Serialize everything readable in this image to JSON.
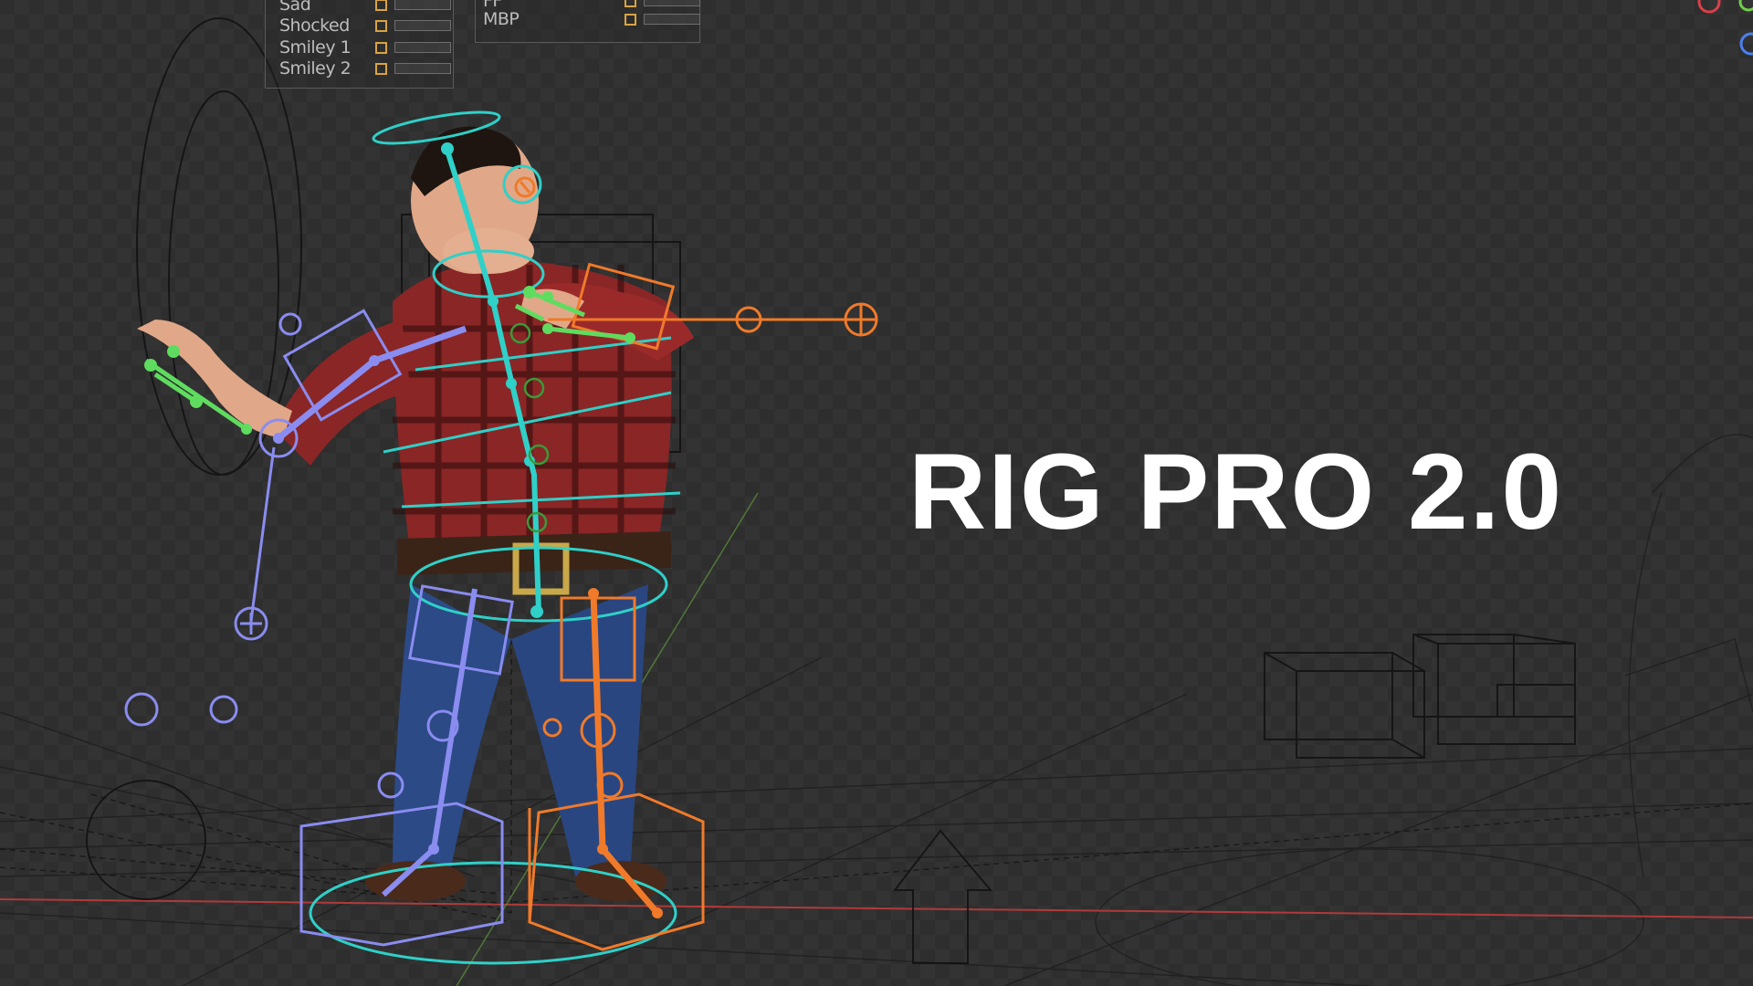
{
  "title": "RIG PRO 2.0",
  "shape_panel_left": {
    "items": [
      {
        "label": "Sad"
      },
      {
        "label": "Shocked"
      },
      {
        "label": "Smiley 1"
      },
      {
        "label": "Smiley 2"
      }
    ]
  },
  "shape_panel_mid": {
    "items": [
      {
        "label": "FF"
      },
      {
        "label": "MBP"
      }
    ]
  },
  "colors": {
    "rig_cyan": "#2fd0c8",
    "rig_orange": "#f07a2a",
    "rig_blue": "#8a8cf0",
    "rig_green": "#5fdc5f",
    "axis_red": "#b03a3a",
    "shirt_red": "#9a2a2a",
    "jeans_blue": "#2c4a86",
    "skin": "#e0a888",
    "checkbox_accent": "#d9a441"
  },
  "icons": [
    "gizmo-red-dot-icon",
    "gizmo-green-dot-icon",
    "gizmo-blue-dot-icon"
  ]
}
